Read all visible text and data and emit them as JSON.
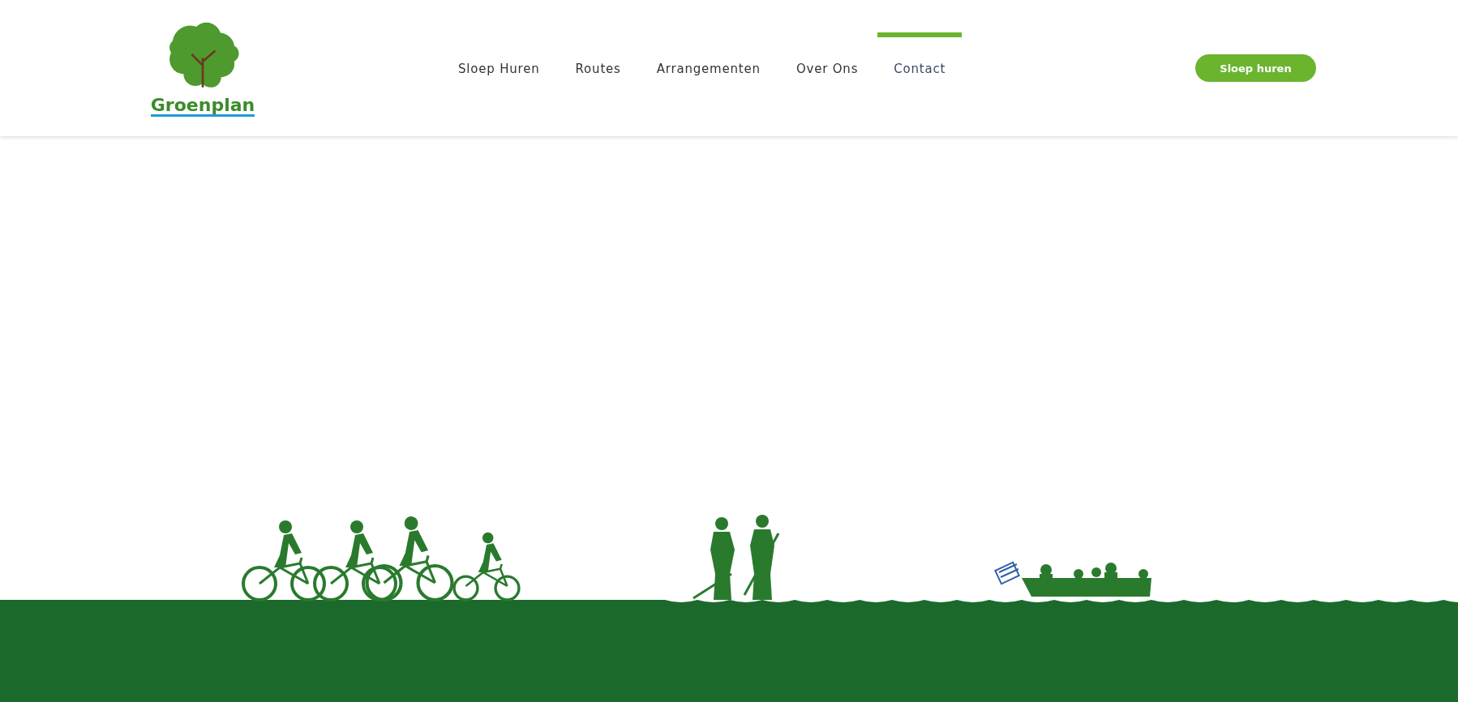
{
  "logo": {
    "text": "Groenplan"
  },
  "nav": [
    {
      "label": "Sloep Huren",
      "selected": false
    },
    {
      "label": "Routes",
      "selected": false
    },
    {
      "label": "Arrangementen",
      "selected": false
    },
    {
      "label": "Over Ons",
      "selected": false
    },
    {
      "label": "Contact",
      "selected": true
    }
  ],
  "cta_button": {
    "label": "Sloep huren"
  }
}
